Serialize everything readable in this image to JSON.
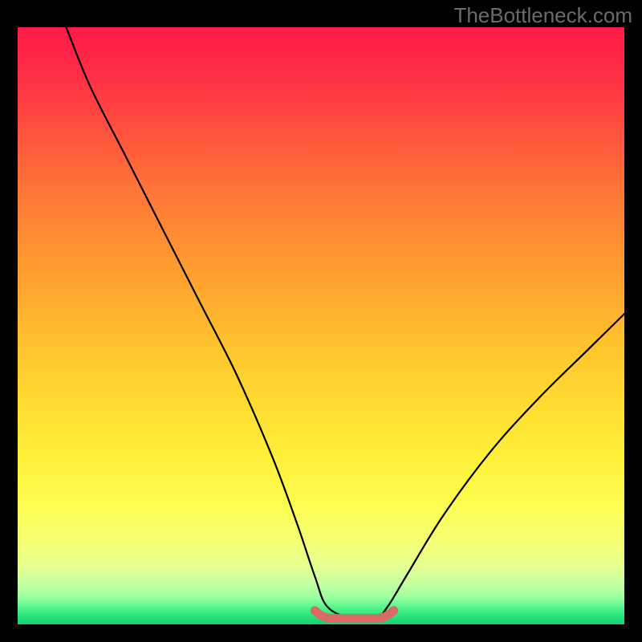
{
  "watermark": "TheBottleneck.com",
  "chart_data": {
    "type": "line",
    "title": "",
    "xlabel": "",
    "ylabel": "",
    "xlim": [
      0,
      100
    ],
    "ylim": [
      0,
      100
    ],
    "grid": false,
    "legend": false,
    "background": "red-to-green-vertical-gradient",
    "description": "V-shaped bottleneck mismatch curve. Left branch falls from ~100% at x≈8 down to a flat minimum near 0% around x≈50–60, then rises to ~50% at x=100.",
    "series": [
      {
        "name": "bottleneck-curve",
        "x": [
          8,
          12,
          18,
          24,
          30,
          36,
          42,
          46,
          49,
          51,
          55,
          59,
          61,
          64,
          70,
          78,
          86,
          94,
          100
        ],
        "values": [
          100,
          90,
          78,
          66,
          54,
          42,
          28,
          17,
          8,
          3,
          1,
          1,
          3,
          8,
          18,
          29,
          38,
          46,
          52
        ]
      }
    ],
    "highlight": {
      "name": "optimal-zone",
      "x_range": [
        49,
        62
      ],
      "y": 1,
      "color": "#d76b67"
    }
  },
  "colors": {
    "frame": "#000000",
    "watermark": "#6b6b6b",
    "curve": "#000000",
    "highlight": "#d76b67"
  }
}
